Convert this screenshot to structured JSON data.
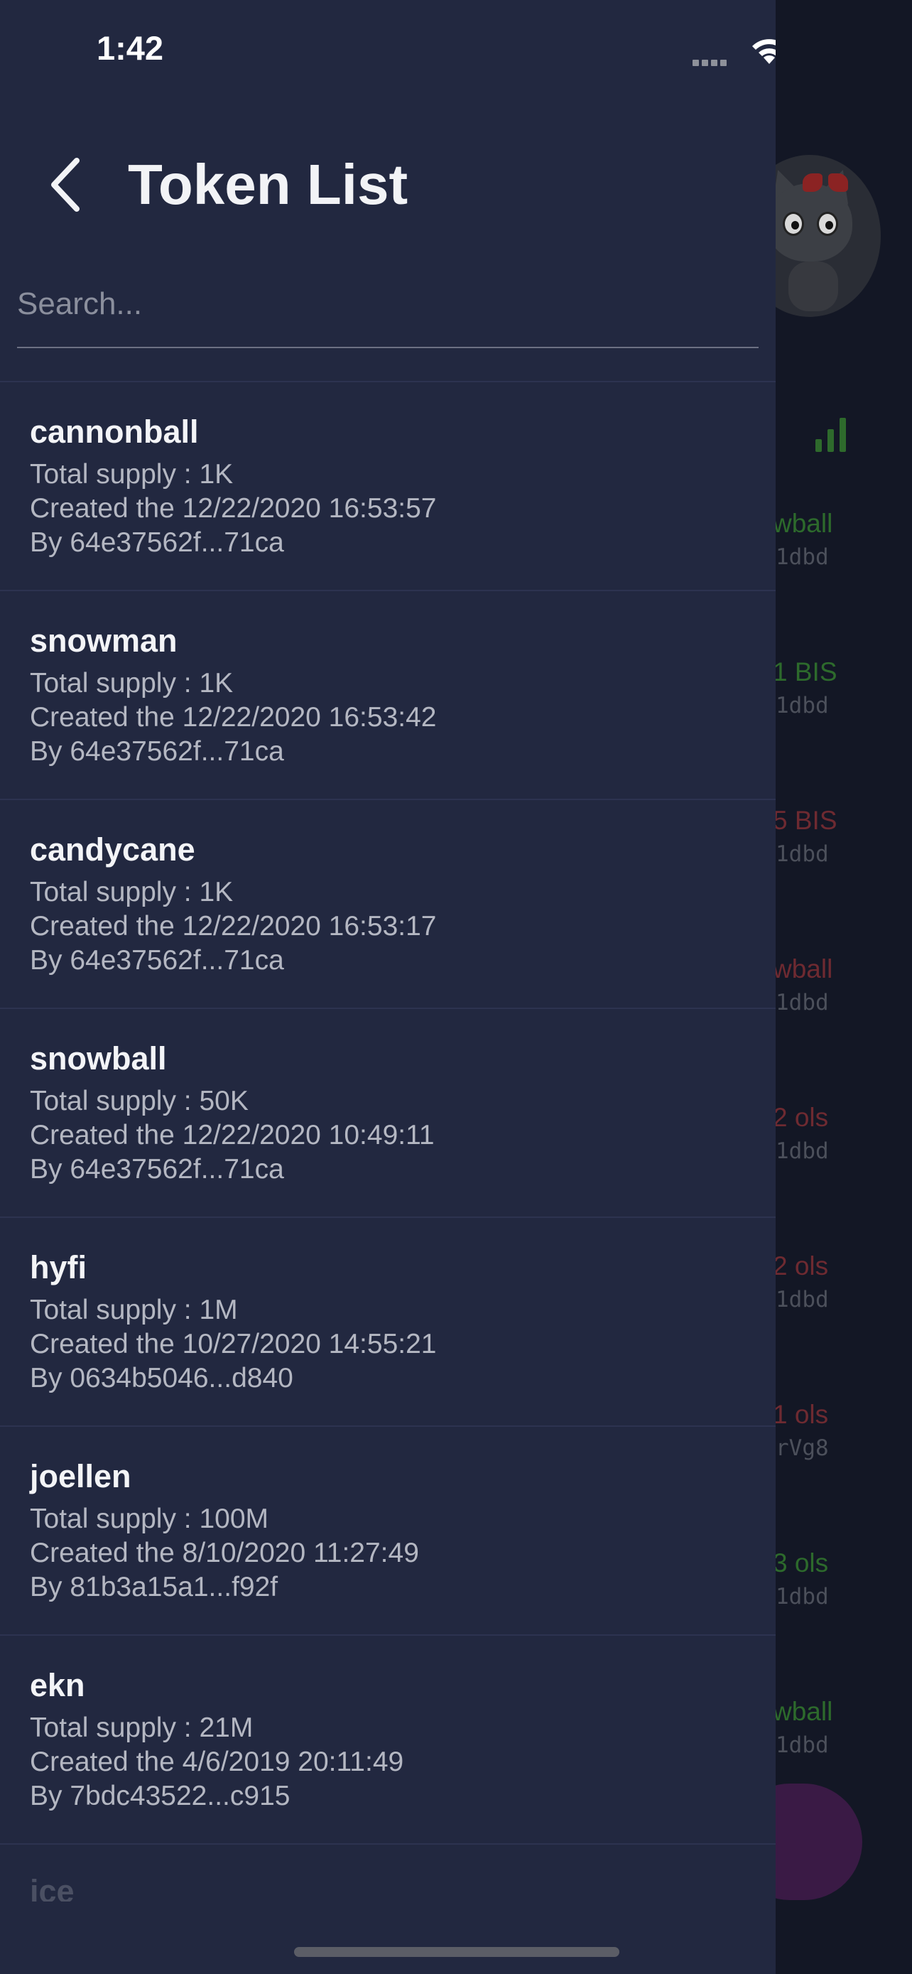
{
  "status_bar": {
    "time": "1:42"
  },
  "header": {
    "title": "Token List"
  },
  "search": {
    "placeholder": "Search..."
  },
  "tokens": [
    {
      "name": "cannonball",
      "supply": "Total supply : 1K",
      "created": "Created the 12/22/2020 16:53:57",
      "by": "By 64e37562f...71ca"
    },
    {
      "name": "snowman",
      "supply": "Total supply : 1K",
      "created": "Created the 12/22/2020 16:53:42",
      "by": "By 64e37562f...71ca"
    },
    {
      "name": "candycane",
      "supply": "Total supply : 1K",
      "created": "Created the 12/22/2020 16:53:17",
      "by": "By 64e37562f...71ca"
    },
    {
      "name": "snowball",
      "supply": "Total supply : 50K",
      "created": "Created the 12/22/2020 10:49:11",
      "by": "By 64e37562f...71ca"
    },
    {
      "name": "hyfi",
      "supply": "Total supply : 1M",
      "created": "Created the 10/27/2020 14:55:21",
      "by": "By 0634b5046...d840"
    },
    {
      "name": "joellen",
      "supply": "Total supply : 100M",
      "created": "Created the 8/10/2020 11:27:49",
      "by": "By 81b3a15a1...f92f"
    },
    {
      "name": "ekn",
      "supply": "Total supply : 21M",
      "created": "Created the 4/6/2019 20:11:49",
      "by": "By 7bdc43522...c915"
    }
  ],
  "partial_token": {
    "name": "ice"
  },
  "background": {
    "rows": [
      {
        "amount": "wball",
        "address": "1dbd",
        "color": "green"
      },
      {
        "amount": "1 BIS",
        "address": "1dbd",
        "color": "green"
      },
      {
        "amount": "5 BIS",
        "address": "1dbd",
        "color": "red"
      },
      {
        "amount": "wball",
        "address": "1dbd",
        "color": "red"
      },
      {
        "amount": "2 ols",
        "address": "1dbd",
        "color": "red"
      },
      {
        "amount": "2 ols",
        "address": "1dbd",
        "color": "red"
      },
      {
        "amount": "1 ols",
        "address": "rVg8",
        "color": "red"
      },
      {
        "amount": "3 ols",
        "address": "1dbd",
        "color": "green"
      },
      {
        "amount": "wball",
        "address": "1dbd",
        "color": "green"
      }
    ]
  },
  "colors": {
    "drawer_bg": "#222840",
    "overlay_bg": "#131725",
    "positive": "#2d6a2c",
    "negative": "#6e2a31",
    "fab": "#3a1a45"
  },
  "icons": {
    "back": "chevron-left-icon",
    "wifi": "wifi-icon",
    "battery": "battery-icon",
    "signal": "signal-bars-icon"
  }
}
